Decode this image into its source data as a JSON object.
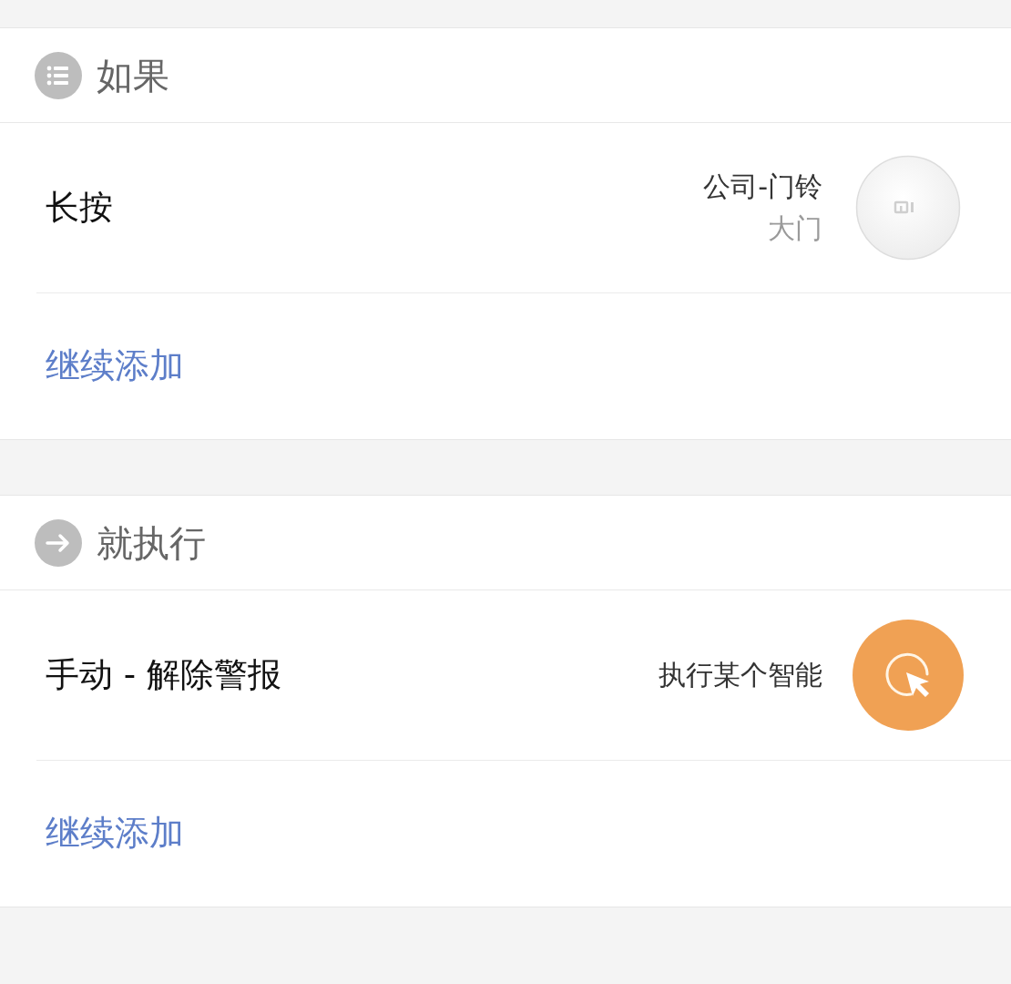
{
  "sections": [
    {
      "kind": "condition",
      "title": "如果",
      "items": [
        {
          "kind": "device",
          "label": "长按",
          "device": "公司-门铃",
          "location": "大门"
        }
      ],
      "add_label": "继续添加"
    },
    {
      "kind": "action",
      "title": "就执行",
      "items": [
        {
          "kind": "scene",
          "label": "手动 - 解除警报",
          "device": "执行某个智能"
        }
      ],
      "add_label": "继续添加"
    }
  ]
}
